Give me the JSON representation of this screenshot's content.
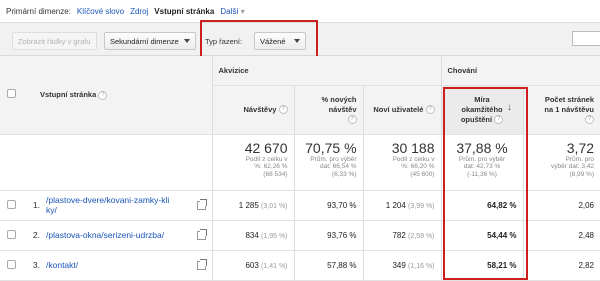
{
  "dimension_bar": {
    "label": "Primární dimenze:",
    "options": [
      "Klíčové slovo",
      "Zdroj"
    ],
    "active": "Vstupní stránka",
    "more": "Další"
  },
  "toolbar": {
    "plot_rows": "Zobrazit řádky v grafu",
    "secondary_dimension": "Sekundární dimenze",
    "sort_label": "Typ řazení:",
    "sort_value": "Vážené"
  },
  "table": {
    "group_acquisition": "Akvizice",
    "group_behavior": "Chování",
    "col_page": "Vstupní stránka",
    "col_visits": "Návštěvy",
    "col_new_visits": [
      "% nových",
      "návštěv"
    ],
    "col_new_users": "Noví uživatelé",
    "col_bounce": [
      "Míra",
      "okamžitého",
      "opuštění"
    ],
    "col_pages": [
      "Počet stránek",
      "na 1 návštěvu"
    ],
    "totals": {
      "visits": {
        "big": "42 670",
        "sub": [
          "Podíl z celku v",
          "%: 62,26 %",
          "(68 534)"
        ]
      },
      "new_visits": {
        "big": "70,75 %",
        "sub": [
          "Prům. pro výběr",
          "dat: 66,54 %",
          "(6,33 %)"
        ]
      },
      "new_users": {
        "big": "30 188",
        "sub": [
          "Podíl z celku v",
          "%: 66,20 %",
          "(45 600)"
        ]
      },
      "bounce": {
        "big": "37,88 %",
        "sub": [
          "Prům. pro výběr",
          "dat: 42,73 %",
          "(-11,36 %)"
        ]
      },
      "pages": {
        "big": "3,72",
        "sub": [
          "Prům. pro",
          "výběr dat: 3,42",
          "(8,99 %)"
        ]
      }
    },
    "rows": [
      {
        "num": "1.",
        "page": [
          "/plastove-dvere/kovani-zamky-kli",
          "ky/"
        ],
        "visits": "1 285",
        "visits_pct": "(3,01 %)",
        "new_visits": "93,70 %",
        "new_users": "1 204",
        "new_users_pct": "(3,99 %)",
        "bounce": "64,82 %",
        "pages": "2,06"
      },
      {
        "num": "2.",
        "page": [
          "/plastova-okna/serizeni-udrzba/"
        ],
        "visits": "834",
        "visits_pct": "(1,95 %)",
        "new_visits": "93,76 %",
        "new_users": "782",
        "new_users_pct": "(2,59 %)",
        "bounce": "54,44 %",
        "pages": "2,48"
      },
      {
        "num": "3.",
        "page": [
          "/kontakt/"
        ],
        "visits": "603",
        "visits_pct": "(1,41 %)",
        "new_visits": "57,88 %",
        "new_users": "349",
        "new_users_pct": "(1,16 %)",
        "bounce": "58,21 %",
        "pages": "2,82"
      }
    ]
  },
  "colors": {
    "highlight": "#cc1f1f",
    "link": "#1a55b8"
  }
}
